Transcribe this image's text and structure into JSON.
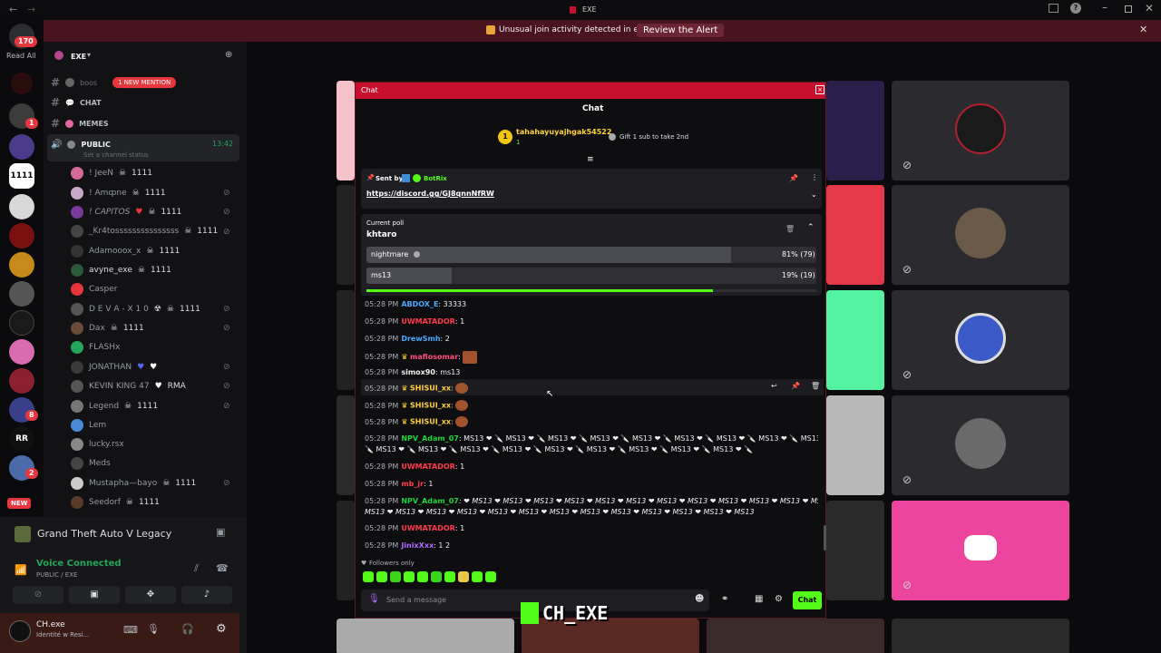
{
  "window": {
    "title": "EXE"
  },
  "banner": {
    "text": "Unusual join activity detected in exe",
    "button": "Review the Alert"
  },
  "rail": {
    "badge_count": "170",
    "read_all": "Read All",
    "exe_badge": "1",
    "new_label": "NEW",
    "badge_8": "8",
    "badge_2": "2",
    "badge_1": "1"
  },
  "server": {
    "name": "EXE"
  },
  "channels": {
    "boost": "boos",
    "new_mention": "1 NEW MENTION",
    "chat": "CHAT",
    "memes": "MEMES",
    "public": "PUBLIC",
    "public_time": "13:42",
    "status_placeholder": "Set a channel status"
  },
  "voice_users": [
    {
      "name": "! JeeN",
      "tag": "1111"
    },
    {
      "name": "! Amȹne",
      "tag": "1111"
    },
    {
      "name": "! CAPITOS",
      "tag": "1111"
    },
    {
      "name": "_Kr4tosssssssssssssss",
      "tag": "1111"
    },
    {
      "name": "Adamooox_x",
      "tag": "1111"
    },
    {
      "name": "avyne_exe",
      "tag": "1111"
    },
    {
      "name": "Casper",
      "tag": ""
    },
    {
      "name": "D E V A - X 1 0",
      "tag": "1111"
    },
    {
      "name": "Dax",
      "tag": "1111"
    },
    {
      "name": "FLASHx",
      "tag": ""
    },
    {
      "name": "JONATHAN",
      "tag": ""
    },
    {
      "name": "KEVIN KING 47",
      "tag": "RMA"
    },
    {
      "name": "Legend",
      "tag": "1111"
    },
    {
      "name": "Lem",
      "tag": ""
    },
    {
      "name": "lucky.rsx",
      "tag": ""
    },
    {
      "name": "Meds",
      "tag": ""
    },
    {
      "name": "Mustapha—bayo",
      "tag": "1111"
    },
    {
      "name": "Seedorf",
      "tag": "1111"
    }
  ],
  "activity": {
    "game": "Grand Theft Auto V Legacy"
  },
  "voice": {
    "status": "Voice Connected",
    "channel": "PUBLIC / EXE"
  },
  "user": {
    "name": "CH.exe",
    "status": "Identité w Resi..."
  },
  "chat": {
    "window_title": "Chat",
    "header_title": "Chat",
    "top_gifter": "tahahayuyajhgak54522",
    "top_gifter_count": "1",
    "gift_prompt": "Gift 1 sub to take 2nd",
    "pinned": {
      "sent_by_label": "Sent by",
      "sender": "BotRix",
      "link": "https://discord.gg/GJ8qnnNfRW"
    },
    "poll": {
      "label": "Current poll",
      "title": "khtaro",
      "options": [
        {
          "name": "nightmare",
          "result": "81% (79)",
          "percent": 81
        },
        {
          "name": "ms13",
          "result": "19% (19)",
          "percent": 19
        }
      ],
      "time_remaining_fraction": 0.77
    },
    "messages": [
      {
        "time": "05:28 PM",
        "user": "ABDOX_E",
        "text": "33333",
        "color": "blue"
      },
      {
        "time": "05:28 PM",
        "user": "UWMATADOR",
        "text": "1",
        "color": "red"
      },
      {
        "time": "05:28 PM",
        "user": "DrewSmh",
        "text": "2",
        "color": "blue"
      },
      {
        "time": "05:28 PM",
        "user": "mafiosomar",
        "text": "",
        "color": "pink"
      },
      {
        "time": "05:28 PM",
        "user": "simox90",
        "text": "ms13",
        "color": "white"
      },
      {
        "time": "05:28 PM",
        "user": "SHISUI_xx",
        "text": "",
        "color": "yellow"
      },
      {
        "time": "05:28 PM",
        "user": "SHISUI_xx",
        "text": "",
        "color": "yellow"
      },
      {
        "time": "05:28 PM",
        "user": "SHISUI_xx",
        "text": "",
        "color": "yellow"
      },
      {
        "time": "05:28 PM",
        "user": "NPV_Adam_07",
        "text": "MS13 ❤ 🔪 MS13 ❤ 🔪 MS13 ❤ 🔪 MS13 ❤ 🔪 MS13 ❤ 🔪 MS13 ❤ 🔪 MS13 ❤ 🔪 MS13 ❤ 🔪 MS13 ❤",
        "text2": "🔪 MS13 ❤ 🔪 MS13 ❤ 🔪 MS13 ❤ 🔪 MS13 ❤ 🔪 MS13 ❤ 🔪 MS13 ❤ 🔪 MS13 ❤ 🔪 MS13 ❤ 🔪 MS13 ❤ 🔪",
        "color": "green"
      },
      {
        "time": "05:28 PM",
        "user": "UWMATADOR",
        "text": "1",
        "color": "red"
      },
      {
        "time": "05:28 PM",
        "user": "mb_jr",
        "text": "1",
        "color": "red"
      },
      {
        "time": "05:28 PM",
        "user": "NPV_Adam_07",
        "text": "❤ MS13 ❤ MS13 ❤ MS13 ❤ MS13 ❤ MS13 ❤ MS13 ❤ MS13 ❤ MS13 ❤ MS13 ❤ MS13 ❤ MS13 ❤ MS13 ❤ MS13",
        "text2": "MS13 ❤ MS13 ❤ MS13 ❤ MS13 ❤ MS13 ❤ MS13 ❤ MS13 ❤ MS13 ❤ MS13 ❤ MS13 ❤ MS13 ❤ MS13 ❤ MS13",
        "color": "green"
      },
      {
        "time": "05:28 PM",
        "user": "UWMATADOR",
        "text": "1",
        "color": "red"
      },
      {
        "time": "05:28 PM",
        "user": "JinixXxx",
        "text": "1 2",
        "color": "purple"
      }
    ],
    "followers_only": "Followers only",
    "input_placeholder": "Send a message",
    "send_button": "Chat"
  },
  "watermark": "CH_EXE"
}
